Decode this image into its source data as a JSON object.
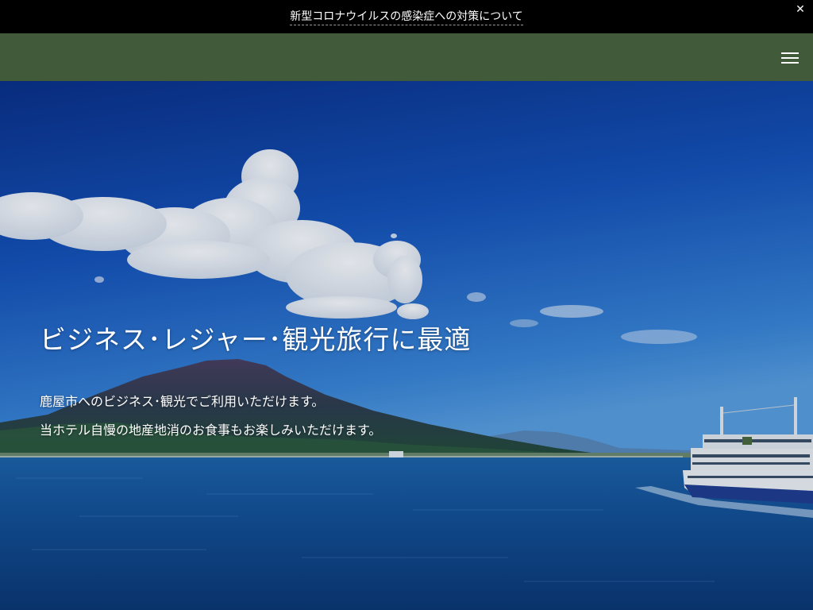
{
  "notice": {
    "text": "新型コロナウイルスの感染症への対策について",
    "close_icon": "close-icon",
    "close_glyph": "✕"
  },
  "header": {
    "background": "#415a3a",
    "menu_icon": "hamburger-menu-icon"
  },
  "hero": {
    "title": "ビジネス･レジャー･観光旅行に最適",
    "lines": [
      "鹿屋市へのビジネス･観光でご利用いただけます。",
      "当ホテル自慢の地産地消のお食事もお楽しみいただけます。"
    ],
    "image": "sky-clouds-volcano-sea-ferry-photo"
  }
}
